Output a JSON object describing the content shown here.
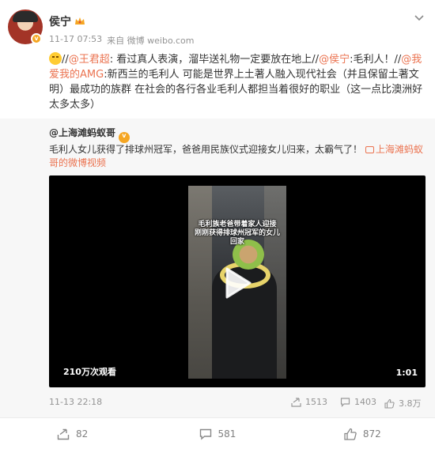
{
  "post": {
    "author": "侯宁",
    "time": "11-17 07:53",
    "source_prefix": "来自",
    "source": "微博 weibo.com",
    "content": {
      "seg1": "//",
      "link1": "@王君超",
      "seg2": ": 看过真人表演，溜毕送礼物一定要放在地上//",
      "link2": "@侯宁",
      "seg3": ":毛利人！//",
      "link3": "@我爱我的AMG",
      "seg4": ":新西兰的毛利人 可能是世界上土著人融入现代社会（并且保留土著文明）最成功的族群 在社会的各行各业毛利人都担当着很好的职业（这一点比澳洲好太多太多）"
    }
  },
  "repost": {
    "author": "@上海滩蚂蚁哥",
    "text": "毛利人女儿获得了排球州冠军，爸爸用民族仪式迎接女儿归来，太霸气了！",
    "video_link": "上海滩蚂蚁哥的微博视频",
    "video": {
      "caption_line1": "毛利族老爸带着家人迎接",
      "caption_line2": "刚刚获得排球州冠军的女儿回家",
      "views": "210万次观看",
      "duration": "1:01"
    },
    "date": "11-13 22:18",
    "reposts": "1513",
    "comments": "1403",
    "likes": "3.8万"
  },
  "actions": {
    "share": "82",
    "comment": "581",
    "like": "872"
  },
  "colors": {
    "link": "#eb7350",
    "meta": "#939393",
    "repost_bg": "#f7f7f7"
  }
}
